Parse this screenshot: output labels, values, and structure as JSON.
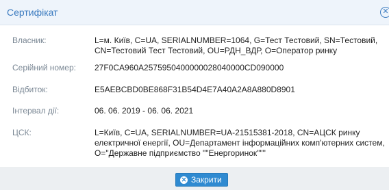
{
  "dialog": {
    "title": "Сертифікат",
    "close_icon": "close-circle-icon",
    "owner_label": "Власник:",
    "owner_value": "L=м. Київ, C=UA, SERIALNUMBER=1064, G=Тест Тестовий, SN=Тестовий, CN=Тестовий Тест Тестовий, OU=РДН_ВДР, O=Оператор ринку",
    "serial_label": "Серійний номер:",
    "serial_value": "27F0CA960A2575950400000028040000CD090000",
    "thumbprint_label": "Відбиток:",
    "thumbprint_value": "E5AEBCBD0BE868F31B54D4E7A40A2A8A880D8901",
    "validity_label": "Інтервал дії:",
    "validity_value": "06. 06. 2019 - 06. 06. 2021",
    "ca_label": "ЦСК:",
    "ca_value": "L=Київ, C=UA, SERIALNUMBER=UA-21515381-2018, CN=АЦСК ринку електричної енергії, OU=Департамент інформаційних комп'ютерних систем, O=\"Державне підприємство \"\"Енергоринок\"\"\"",
    "close_button_label": "Закрити",
    "close_button_icon": "close-circle-icon",
    "accent_color": "#3a7abf",
    "button_color": "#2f8ad1"
  }
}
